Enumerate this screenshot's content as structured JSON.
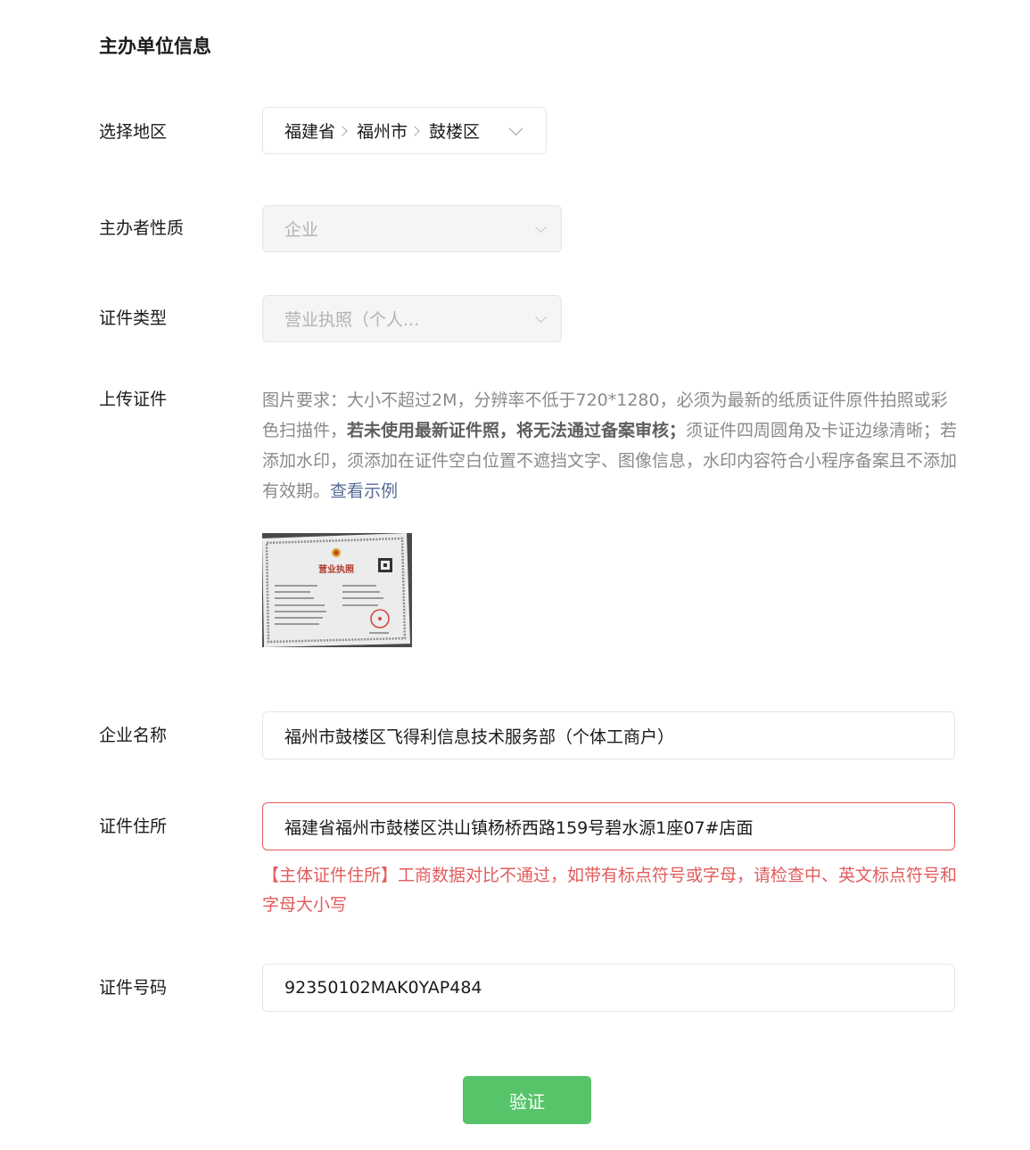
{
  "section_title": "主办单位信息",
  "region": {
    "label": "选择地区",
    "province": "福建省",
    "city": "福州市",
    "district": "鼓楼区"
  },
  "organizer_type": {
    "label": "主办者性质",
    "value": "企业"
  },
  "cert_type": {
    "label": "证件类型",
    "value": "营业执照（个人..."
  },
  "upload": {
    "label": "上传证件",
    "text_1": "图片要求：大小不超过2M，分辨率不低于720*1280，必须为最新的纸质证件原件拍照或彩色扫描件，",
    "text_bold": "若未使用最新证件照，将无法通过备案审核；",
    "text_2": "须证件四周圆角及卡证边缘清晰；若添加水印，须添加在证件空白位置不遮挡文字、图像信息，水印内容符合小程序备案且不添加有效期。",
    "link": "查看示例",
    "thumbnail_title": "营业执照"
  },
  "company_name": {
    "label": "企业名称",
    "value": "福州市鼓楼区飞得利信息技术服务部（个体工商户）"
  },
  "cert_address": {
    "label": "证件住所",
    "value": "福建省福州市鼓楼区洪山镇杨桥西路159号碧水源1座07#店面",
    "error": "【主体证件住所】工商数据对比不通过，如带有标点符号或字母，请检查中、英文标点符号和字母大小写"
  },
  "cert_number": {
    "label": "证件号码",
    "value": "92350102MAK0YAP484"
  },
  "submit_label": "验证",
  "colors": {
    "accent_green": "#57c46a",
    "error_red": "#e25c5c",
    "link_blue": "#576b95"
  }
}
